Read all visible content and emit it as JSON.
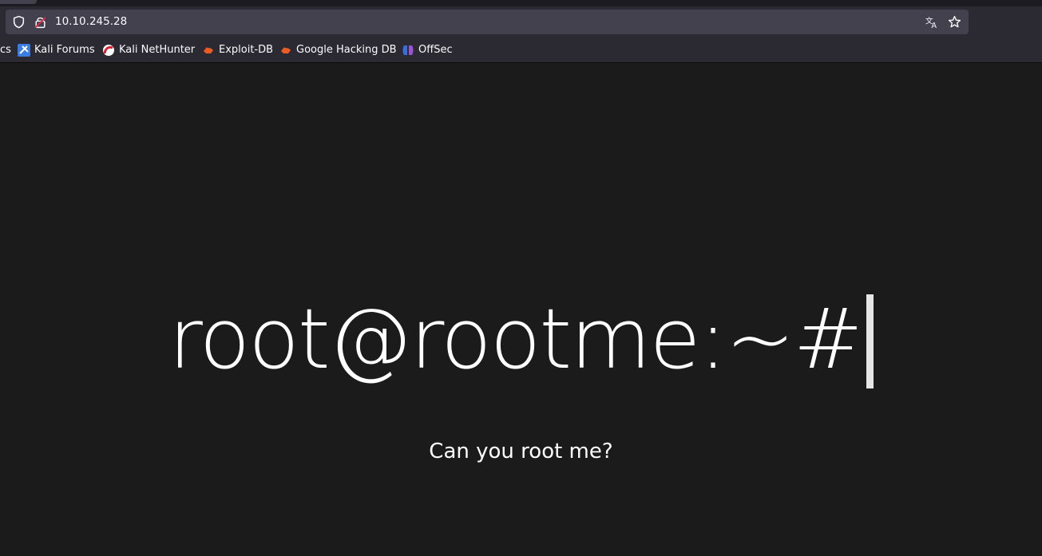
{
  "browser": {
    "url": "10.10.245.28",
    "icons": {
      "shield": "shield-icon",
      "lock": "insecure-lock-icon",
      "translate": "translate-icon",
      "bookmark_star": "star-icon"
    }
  },
  "bookmarks": [
    {
      "label": "cs",
      "icon": ""
    },
    {
      "label": "Kali Forums",
      "icon": "kali-forums-icon"
    },
    {
      "label": "Kali NetHunter",
      "icon": "kali-nethunter-icon"
    },
    {
      "label": "Exploit-DB",
      "icon": "exploit-db-icon"
    },
    {
      "label": "Google Hacking DB",
      "icon": "exploit-db-icon"
    },
    {
      "label": "OffSec",
      "icon": "offsec-icon"
    }
  ],
  "page": {
    "headline": "root@rootme:~#",
    "subtitle": "Can you root me?"
  },
  "colors": {
    "page_background": "#1b1b1b",
    "text": "#ffffff",
    "toolbar": "#2b2a33",
    "urlbar": "#42414d",
    "lock_warning": "#e22850",
    "exploitdb_orange": "#ec5b24"
  }
}
